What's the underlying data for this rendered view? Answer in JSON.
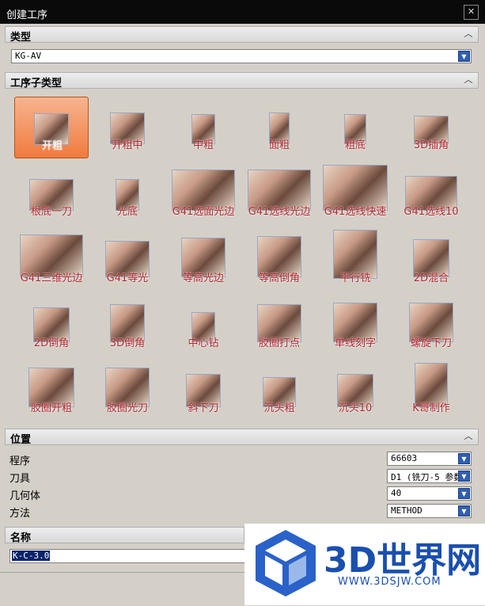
{
  "window": {
    "title": "创建工序"
  },
  "type_section": {
    "header": "类型",
    "value": "KG-AV"
  },
  "subtype_section": {
    "header": "工序子类型",
    "tiles": [
      {
        "label": "开粗",
        "selected": true
      },
      {
        "label": "开粗中"
      },
      {
        "label": "中粗"
      },
      {
        "label": "面粗"
      },
      {
        "label": "粗底"
      },
      {
        "label": "3D插角"
      },
      {
        "label": "根底一刀"
      },
      {
        "label": "光底"
      },
      {
        "label": "G41选面光边"
      },
      {
        "label": "G41选线光边"
      },
      {
        "label": "G41选线快速"
      },
      {
        "label": "G41选线10"
      },
      {
        "label": "G41三维光边"
      },
      {
        "label": "G41等光"
      },
      {
        "label": "等高光边"
      },
      {
        "label": "等高倒角"
      },
      {
        "label": "平行铣"
      },
      {
        "label": "2D混合"
      },
      {
        "label": "2D倒角"
      },
      {
        "label": "3D倒角"
      },
      {
        "label": "中心钻"
      },
      {
        "label": "胶圈打点"
      },
      {
        "label": "单线刻字"
      },
      {
        "label": "螺旋下刀"
      },
      {
        "label": "胶圈开粗"
      },
      {
        "label": "胶圈光刀"
      },
      {
        "label": "斜下刀"
      },
      {
        "label": "沉头粗"
      },
      {
        "label": "沉头10"
      },
      {
        "label": "K哥制作"
      }
    ]
  },
  "location_section": {
    "header": "位置",
    "rows": [
      {
        "label": "程序",
        "value": "66603"
      },
      {
        "label": "刀具",
        "value": "D1 (铣刀-5 参数"
      },
      {
        "label": "几何体",
        "value": "40"
      },
      {
        "label": "方法",
        "value": "METHOD"
      }
    ]
  },
  "name_section": {
    "header": "名称",
    "value": "K-C-3.0"
  },
  "watermark": {
    "brand": "3D世界网",
    "url": "WWW.3DSJW.COM"
  }
}
